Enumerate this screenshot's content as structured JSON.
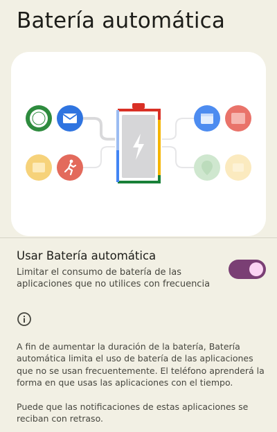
{
  "page": {
    "title": "Batería automática"
  },
  "illustration": {
    "left_apps": [
      "messages-icon",
      "mail-icon",
      "folder-icon",
      "running-icon"
    ],
    "right_apps": [
      "calendar-icon",
      "photos-icon",
      "maps-icon",
      "app-icon"
    ],
    "center": "battery-charging-icon",
    "colors": {
      "green": "#2e8b3e",
      "blue": "#2f74e0",
      "yellow": "#f6d27a",
      "red": "#e36a5c",
      "battery_top": "#d93025",
      "battery_right": "#f4b400",
      "battery_bottom": "#188038",
      "battery_left": "#4285f4",
      "battery_fill": "#d6d6d8"
    }
  },
  "setting": {
    "title": "Usar Batería automática",
    "summary": "Limitar el consumo de batería de las aplicaciones que no utilices con frecuencia",
    "enabled": true,
    "toggle_color": "#7a3f74"
  },
  "info": {
    "paragraph1": "A fin de aumentar la duración de la batería, Batería automática limita el uso de batería de las aplicaciones que no se usan frecuentemente. El teléfono aprenderá la forma en que usas las aplicaciones con el tiempo.",
    "paragraph2": "Puede que las notificaciones de estas aplicaciones se reciban con retraso."
  }
}
